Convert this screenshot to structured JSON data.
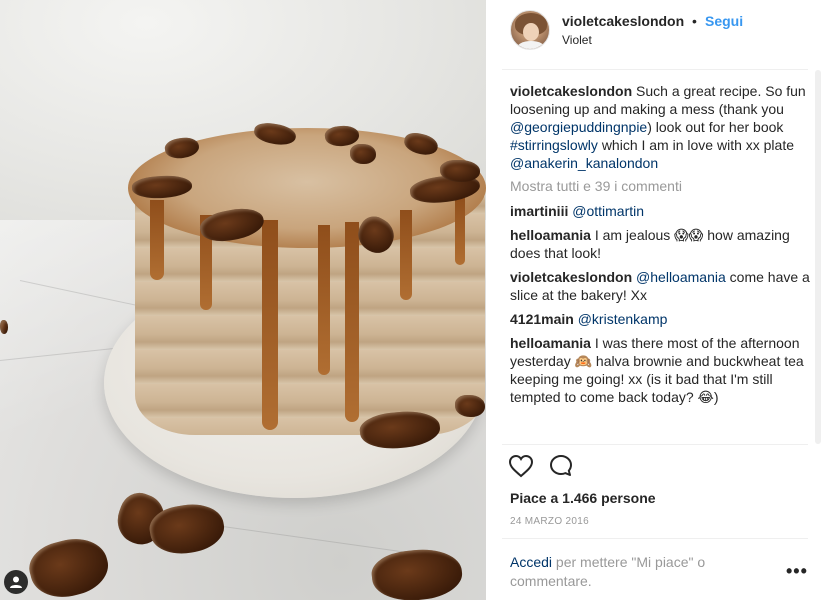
{
  "post": {
    "username": "violetcakeslondon",
    "separator": "•",
    "follow_label": "Segui",
    "location": "Violet"
  },
  "caption": {
    "username": "violetcakeslondon",
    "text_1": "Such a great recipe. So fun loosening up and making a mess (thank you",
    "mention_1": "@georgiepuddingnpie",
    "text_2": ") look out for her book",
    "hashtag": "#stirringslowly",
    "text_3": "which I am in love with xx plate",
    "mention_2": "@anakerin_kanalondon"
  },
  "show_all_comments": "Mostra tutti e 39 i commenti",
  "comments": [
    {
      "username": "imartiniii",
      "mention": "@ottimartin",
      "text": ""
    },
    {
      "username": "helloamania",
      "mention": "",
      "text": "I am jealous 😱😱 how amazing does that look!"
    },
    {
      "username": "violetcakeslondon",
      "mention": "@helloamania",
      "text": "come have a slice at the bakery! Xx"
    },
    {
      "username": "4121main",
      "mention": "@kristenkamp",
      "text": ""
    },
    {
      "username": "helloamania",
      "mention": "",
      "text": "I was there most of the afternoon yesterday 🙉 halva brownie and buckwheat tea keeping me going! xx (is it bad that I'm still tempted to come back today? 😂)"
    }
  ],
  "icons": {
    "like": "heart-icon",
    "comment": "comment-icon",
    "tag": "user-tag-icon",
    "options": "more-options-icon"
  },
  "likes_text": "Piace a 1.466 persone",
  "date": "24 MARZO 2016",
  "login": {
    "link": "Accedi",
    "text": "per mettere \"Mi piace\" o commentare."
  },
  "options_label": "•••",
  "colors": {
    "link_blue": "#3897f0",
    "mention": "#003569",
    "muted": "#999999",
    "text": "#262626"
  }
}
